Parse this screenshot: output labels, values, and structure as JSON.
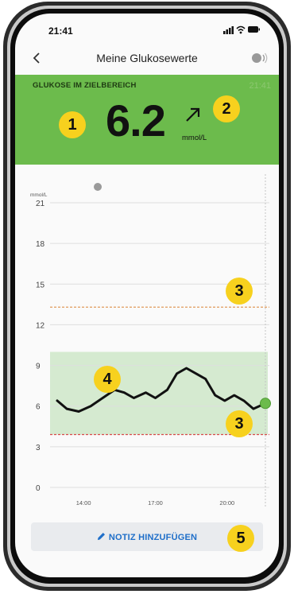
{
  "status_bar": {
    "time": "21:41"
  },
  "nav": {
    "title": "Meine Glukosewerte"
  },
  "glucose": {
    "label": "GLUKOSE IM ZIELBEREICH",
    "time": "21:41",
    "value": "6.2",
    "unit": "mmol/L",
    "trend": "rising-slowly",
    "card_color": "#6cbb4c"
  },
  "chart_data": {
    "type": "line",
    "unit_label": "mmol/L",
    "y_ticks": [
      "21",
      "18",
      "15",
      "12",
      "9",
      "6",
      "3",
      "0"
    ],
    "x_ticks": [
      "14:00",
      "17:00",
      "20:00"
    ],
    "ylim": [
      0,
      21
    ],
    "target_range": [
      3.9,
      10.0
    ],
    "high_threshold": 13.3,
    "low_threshold": 3.9,
    "x_hours": [
      12.9,
      13.3,
      13.8,
      14.3,
      14.8,
      15.3,
      15.7,
      16.1,
      16.6,
      17.0,
      17.5,
      17.9,
      18.3,
      18.7,
      19.1,
      19.5,
      19.9,
      20.3,
      20.7,
      21.1,
      21.6
    ],
    "values": [
      6.4,
      5.8,
      5.6,
      6.0,
      6.6,
      7.2,
      7.0,
      6.6,
      7.0,
      6.6,
      7.2,
      8.4,
      8.8,
      8.4,
      8.0,
      6.8,
      6.4,
      6.8,
      6.4,
      5.8,
      6.2
    ],
    "x_range": [
      12.6,
      21.7
    ],
    "line_color": "#111111",
    "range_color": "#d5ead0",
    "threshold_color": "#d84a4a"
  },
  "actions": {
    "add_note": "NOTIZ HINZUFÜGEN"
  },
  "badges": [
    "1",
    "2",
    "3",
    "3",
    "4",
    "5"
  ]
}
